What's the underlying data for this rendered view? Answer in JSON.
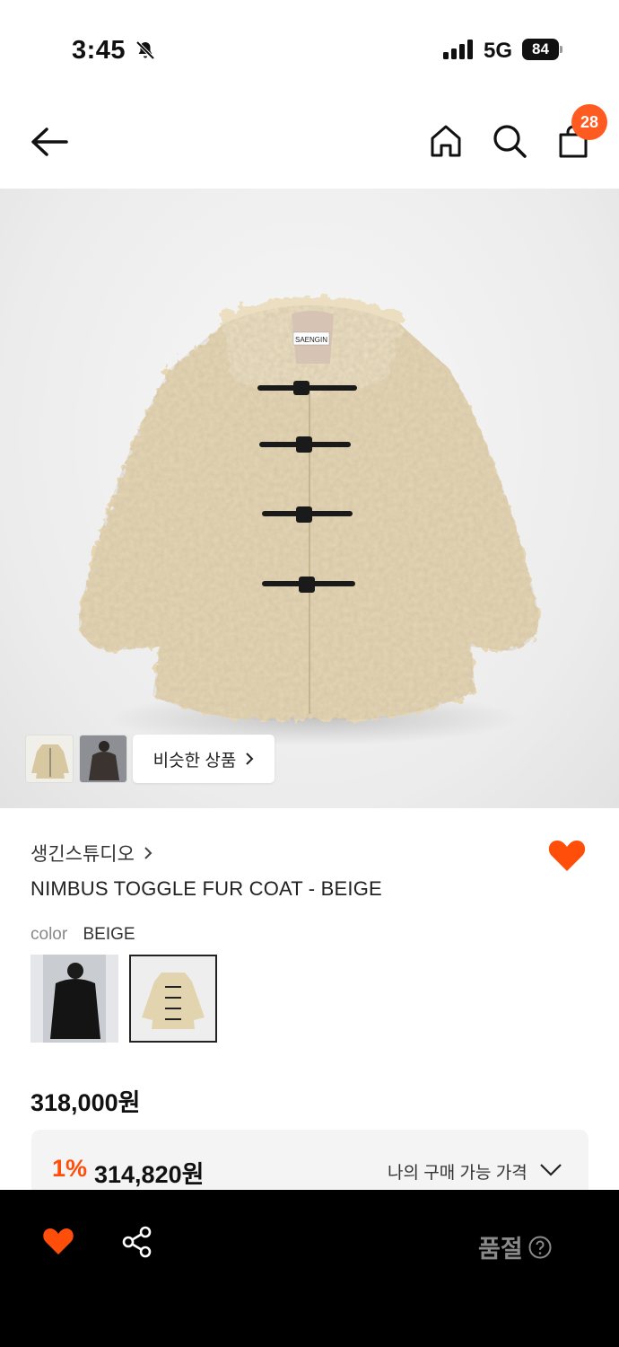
{
  "status": {
    "time": "3:45",
    "network": "5G",
    "battery": "84"
  },
  "header": {
    "cart_count": "28"
  },
  "hero": {
    "label_text": "SAENGIN",
    "similar_label": "비슷한 상품"
  },
  "product": {
    "brand": "생긴스튜디오",
    "name": "NIMBUS TOGGLE FUR COAT - BEIGE",
    "color_label": "color",
    "color_value": "BEIGE",
    "price": "318,000원",
    "discount_rate": "1%",
    "discount_price": "314,820원",
    "my_price_label": "나의 구매 가능 가격"
  },
  "bottom_bar": {
    "status_label": "품절"
  },
  "colors": {
    "accent": "#ff4d0a",
    "badge": "#ff5a1f",
    "coat": "#e8d9b8"
  }
}
